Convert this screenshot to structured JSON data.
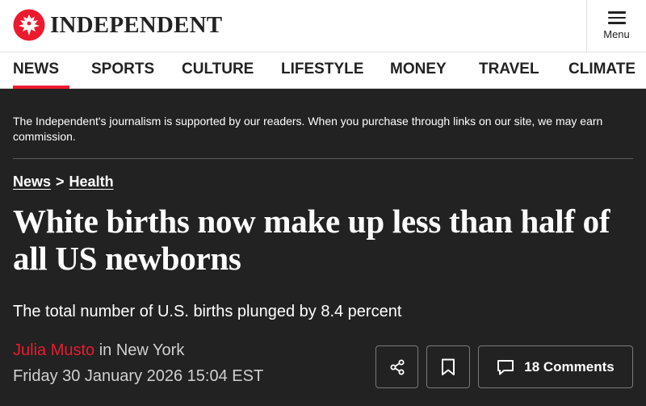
{
  "header": {
    "logo_text": "INDEPENDENT",
    "menu_label": "Menu"
  },
  "nav": {
    "items": [
      "NEWS",
      "SPORTS",
      "CULTURE",
      "LIFESTYLE",
      "MONEY",
      "TRAVEL",
      "CLIMATE"
    ],
    "active": "NEWS"
  },
  "disclaimer": "The Independent's journalism is supported by our readers. When you purchase through links on our site, we may earn commission.",
  "breadcrumb": {
    "section": "News",
    "separator": ">",
    "subsection": "Health"
  },
  "article": {
    "headline": "White births now make up less than half of all US newborns",
    "subhead": "The total number of U.S. births plunged by 8.4 percent",
    "author": "Julia Musto",
    "location_text": " in New York",
    "date": "Friday 30 January 2026 15:04 EST"
  },
  "actions": {
    "comments_label": "18 Comments"
  },
  "icons": {
    "logo": "independent-eagle-icon",
    "menu": "hamburger-menu-icon",
    "share": "share-icon",
    "bookmark": "bookmark-icon",
    "comments": "comment-icon"
  },
  "colors": {
    "brand_red": "#ec1a2e",
    "page_background": "#222222",
    "header_background": "#ffffff"
  }
}
